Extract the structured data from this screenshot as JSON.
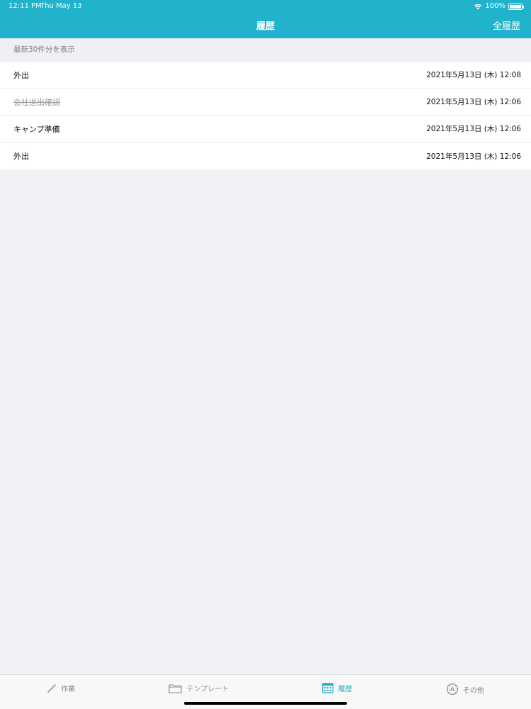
{
  "status_bar": {
    "time": "12:11 PM",
    "date": "Thu May 13",
    "battery": "100%"
  },
  "nav": {
    "title": "履歴",
    "right_button": "全履歴"
  },
  "section_header": "最新30件分を表示",
  "history": [
    {
      "title": "外出",
      "timestamp": "2021年5月13日 (木) 12:08",
      "struck": false
    },
    {
      "title": "会社退出確認",
      "timestamp": "2021年5月13日 (木) 12:06",
      "struck": true
    },
    {
      "title": "キャンプ準備",
      "timestamp": "2021年5月13日 (木) 12:06",
      "struck": false
    },
    {
      "title": "外出",
      "timestamp": "2021年5月13日 (木) 12:06",
      "struck": false
    }
  ],
  "tabs": [
    {
      "label": "作業",
      "icon": "pencil-icon",
      "active": false
    },
    {
      "label": "テンプレート",
      "icon": "folder-icon",
      "active": false
    },
    {
      "label": "履歴",
      "icon": "calendar-icon",
      "active": true
    },
    {
      "label": "その他",
      "icon": "gear-icon",
      "active": false
    }
  ],
  "colors": {
    "accent": "#22b3cc",
    "tab_active": "#22a8c4",
    "background": "#f1f1f6"
  }
}
